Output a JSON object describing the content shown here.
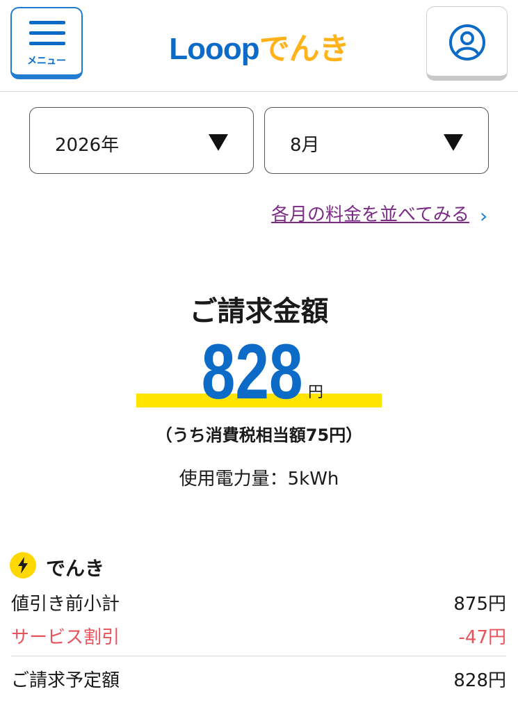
{
  "header": {
    "menu_label": "メニュー",
    "logo_part1": "Looop",
    "logo_part2": "でんき",
    "menu_icon": "hamburger-icon",
    "account_icon": "user-circle-icon"
  },
  "filters": {
    "year": "2026年",
    "month": "8月",
    "dropdown_icon": "triangle-down-icon"
  },
  "compare_link": {
    "label": "各月の料金を並べてみる",
    "chevron": "›"
  },
  "bill": {
    "title": "ご請求金額",
    "amount": "828",
    "unit": "円",
    "tax_note": "（うち消費税相当額75円）",
    "usage": "使用電力量：5kWh"
  },
  "breakdown": {
    "section_label": "でんき",
    "section_icon": "lightning-bolt-icon",
    "rows": [
      {
        "label": "値引き前小計",
        "value": "875円"
      },
      {
        "label": "サービス割引",
        "value": "-47円"
      },
      {
        "label": "ご請求予定額",
        "value": "828円"
      }
    ]
  },
  "colors": {
    "brand_blue": "#0b6bc7",
    "brand_orange": "#ffb21a",
    "highlight_yellow": "#ffe400",
    "discount_red": "#e8525a",
    "link_purple": "#7b2b86"
  }
}
